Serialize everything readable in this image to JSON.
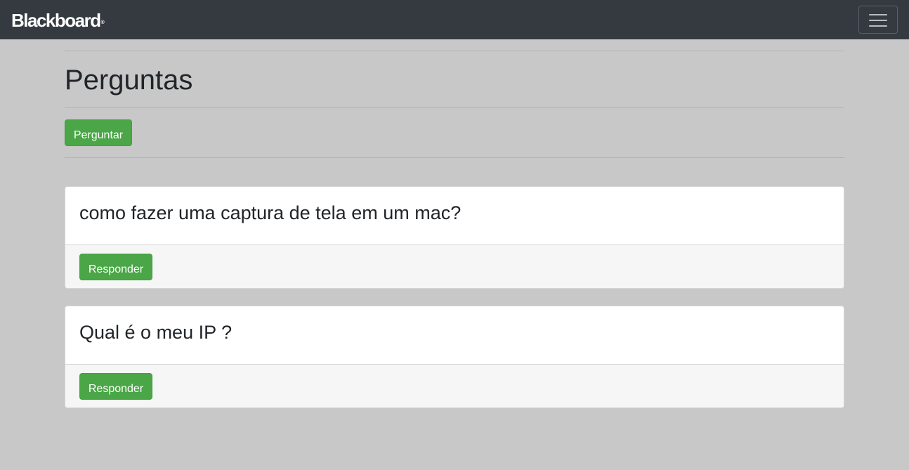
{
  "navbar": {
    "brand": "Blackboard",
    "brand_mark": "®",
    "menu_icon": "hamburger-menu-icon"
  },
  "page": {
    "title": "Perguntas",
    "ask_button": "Perguntar"
  },
  "questions": [
    {
      "title": "como fazer uma captura de tela em um mac?",
      "reply_button": "Responder"
    },
    {
      "title": "Qual é o meu IP ?",
      "reply_button": "Responder"
    }
  ],
  "colors": {
    "navbar_bg": "#343a40",
    "page_bg": "#c8c8c8",
    "button_green": "#4aa647",
    "card_footer_bg": "#f6f6f6"
  }
}
